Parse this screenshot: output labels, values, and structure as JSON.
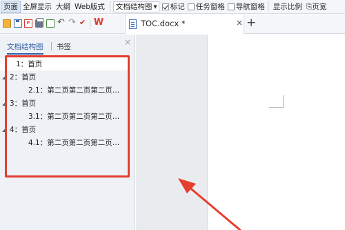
{
  "ribbon": {
    "page_view": "页面",
    "fullscreen": "全屏显示",
    "outline": "大纲",
    "web_layout": "Web版式",
    "doc_map_dropdown": "文档结构图",
    "markup": "标记",
    "task_pane": "任务窗格",
    "nav_pane": "导航窗格",
    "zoom": "显示比例",
    "page_width": "页宽"
  },
  "toolbar": {
    "icons": [
      "open-icon",
      "save-icon",
      "pdf-icon",
      "print-icon",
      "print-preview-icon",
      "undo-icon",
      "redo-icon",
      "format-painter-icon",
      "wps-logo-icon"
    ],
    "wps_label": "W"
  },
  "document_tab": {
    "title": "TOC.docx *",
    "close": "×",
    "new_tab": "+"
  },
  "nav_pane": {
    "tabs": [
      "文档结构图",
      "书签"
    ],
    "close": "×",
    "items": [
      {
        "label": "1：首页",
        "level": 1,
        "toggle": "",
        "selected": true
      },
      {
        "label": "2：首页",
        "level": 1,
        "toggle": "◢",
        "selected": false
      },
      {
        "label": "2.1：第二页第二页第二页…",
        "level": 2,
        "toggle": "",
        "selected": false
      },
      {
        "label": "3：首页",
        "level": 1,
        "toggle": "◢",
        "selected": false
      },
      {
        "label": "3.1：第二页第二页第二页…",
        "level": 2,
        "toggle": "",
        "selected": false
      },
      {
        "label": "4：首页",
        "level": 1,
        "toggle": "◢",
        "selected": false
      },
      {
        "label": "4.1：第二页第二页第二页…",
        "level": 2,
        "toggle": "",
        "selected": false
      }
    ]
  },
  "colors": {
    "highlight": "#e53d2e",
    "accent": "#2e5ea8"
  }
}
